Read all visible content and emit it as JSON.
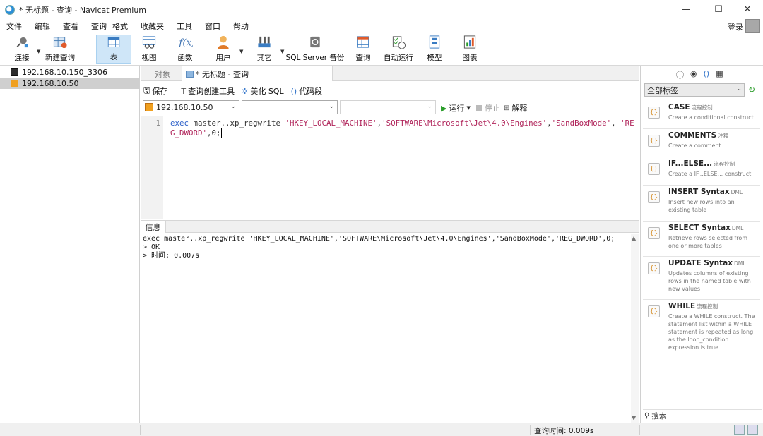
{
  "window": {
    "title": "* 无标题 - 查询 - Navicat Premium",
    "minimize": "—",
    "maximize": "☐",
    "close": "✕"
  },
  "menu": {
    "items": [
      "文件",
      "编辑",
      "查看",
      "查询",
      "格式",
      "收藏夹",
      "工具",
      "窗口",
      "帮助"
    ],
    "login": "登录"
  },
  "toolbar": {
    "connect": "连接",
    "new_query": "新建查询",
    "table": "表",
    "view": "视图",
    "function": "函数",
    "user": "用户",
    "other": "其它",
    "sqlserver_backup": "SQL Server 备份",
    "query": "查询",
    "auto_run": "自动运行",
    "model": "模型",
    "chart": "图表"
  },
  "connections": [
    {
      "name": "192.168.10.150_3306",
      "selected": false
    },
    {
      "name": "192.168.10.50",
      "selected": true
    }
  ],
  "tabs": {
    "objects": "对象",
    "query_tab": "* 无标题 - 查询"
  },
  "query_toolbar": {
    "save": "保存",
    "query_builder": "查询创建工具",
    "beautify": "美化 SQL",
    "code_snippet": "代码段"
  },
  "connection_row": {
    "connection": "192.168.10.50",
    "database": "",
    "schema": "",
    "run": "运行",
    "stop": "停止",
    "explain": "解释"
  },
  "editor": {
    "line_number": "1",
    "kw": "exec",
    "plain1": " master..xp_regwrite ",
    "s1": "'HKEY_LOCAL_MACHINE'",
    "c1": ",",
    "s2": "'SOFTWARE\\Microsoft\\Jet\\4.0\\Engines'",
    "c2": ",",
    "s3": "'SandBoxMode'",
    "c3": ", ",
    "s4": "'REG_DWORD'",
    "tail": ",0;"
  },
  "info": {
    "tab": "信息",
    "lines": [
      "exec master..xp_regwrite 'HKEY_LOCAL_MACHINE','SOFTWARE\\Microsoft\\Jet\\4.0\\Engines','SandBoxMode','REG_DWORD',0;",
      "> OK",
      "> 时间: 0.007s"
    ]
  },
  "right_panel": {
    "filter": "全部标签",
    "search": "搜索",
    "snippets": [
      {
        "title": "CASE",
        "tag": "流程控制",
        "desc": "Create a conditional construct"
      },
      {
        "title": "COMMENTS",
        "tag": "注释",
        "desc": "Create a comment"
      },
      {
        "title": "IF...ELSE...",
        "tag": "流程控制",
        "desc": "Create a IF...ELSE... construct"
      },
      {
        "title": "INSERT Syntax",
        "tag": "DML",
        "desc": "Insert new rows into an existing table"
      },
      {
        "title": "SELECT Syntax",
        "tag": "DML",
        "desc": "Retrieve rows selected from one or more tables"
      },
      {
        "title": "UPDATE Syntax",
        "tag": "DML",
        "desc": "Updates columns of existing rows in the named table with new values"
      },
      {
        "title": "WHILE",
        "tag": "流程控制",
        "desc": "Create a WHILE construct. The statement list within a WHILE statement is repeated as long as the loop_condition expression is true."
      }
    ]
  },
  "status": {
    "query_time": "查询时间: 0.009s"
  }
}
